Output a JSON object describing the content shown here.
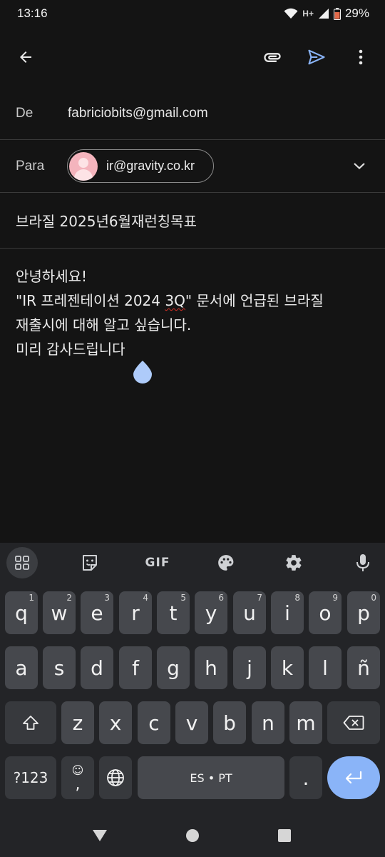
{
  "status": {
    "time": "13:16",
    "network": "H+",
    "battery": "29%"
  },
  "appbar": {
    "back_icon": "arrow-left-icon",
    "attach_icon": "paperclip-icon",
    "send_icon": "send-icon",
    "more_icon": "more-vert-icon"
  },
  "compose": {
    "from_label": "De",
    "from_value": "fabriciobits@gmail.com",
    "to_label": "Para",
    "to_chip": "ir@gravity.co.kr",
    "subject": "브라질 2025년6월재런칭목표",
    "body_lines": [
      "안녕하세요!",
      "\"IR 프레젠테이션 2024 3Q\" 문서에 언급된 브라질",
      "재출시에 대해 알고 싶습니다.",
      "미리 감사드립니다"
    ],
    "body_line2_prefix": "\"IR 프레젠테이션 2024 ",
    "body_line2_misspelled": "3Q",
    "body_line2_suffix": "\" 문서에 언급된 브라질"
  },
  "keyboard": {
    "toolbar": [
      "apps-grid-icon",
      "sticker-icon",
      "GIF",
      "palette-icon",
      "settings-icon",
      "mic-icon"
    ],
    "gif_label": "GIF",
    "row1": [
      {
        "k": "q",
        "h": "1"
      },
      {
        "k": "w",
        "h": "2"
      },
      {
        "k": "e",
        "h": "3"
      },
      {
        "k": "r",
        "h": "4"
      },
      {
        "k": "t",
        "h": "5"
      },
      {
        "k": "y",
        "h": "6"
      },
      {
        "k": "u",
        "h": "7"
      },
      {
        "k": "i",
        "h": "8"
      },
      {
        "k": "o",
        "h": "9"
      },
      {
        "k": "p",
        "h": "0"
      }
    ],
    "row2": [
      "a",
      "s",
      "d",
      "f",
      "g",
      "h",
      "j",
      "k",
      "l",
      "ñ"
    ],
    "row3": [
      "z",
      "x",
      "c",
      "v",
      "b",
      "n",
      "m"
    ],
    "symbols_label": "?123",
    "comma_label": ",",
    "space_label": "ES • PT",
    "period_label": ".",
    "accent_color": "#8ab4f8"
  },
  "navbar": [
    "back-triangle-icon",
    "home-circle-icon",
    "recents-square-icon"
  ]
}
